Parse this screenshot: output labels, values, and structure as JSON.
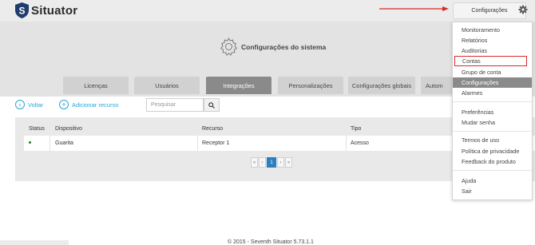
{
  "app": {
    "name": "Situator"
  },
  "topbar": {
    "config_button": "Configurações"
  },
  "header": {
    "title": "Configurações do sistema"
  },
  "tabs": [
    {
      "label": "Licenças"
    },
    {
      "label": "Usuários"
    },
    {
      "label": "Integrações",
      "active": true
    },
    {
      "label": "Personalizações"
    },
    {
      "label": "Configurações globais"
    },
    {
      "label": "Autom"
    }
  ],
  "toolbar": {
    "back_label": "Voltar",
    "add_label": "Adicionar recurso",
    "search_placeholder": "Pesquisar"
  },
  "table": {
    "columns": [
      "Status",
      "Dispositivo",
      "Recurso",
      "Tipo"
    ],
    "rows": [
      {
        "status": "active",
        "dispositivo": "Guarita",
        "recurso": "Receptor 1",
        "tipo": "Acesso"
      }
    ]
  },
  "pagination": {
    "first": "«",
    "prev": "‹",
    "current": "1",
    "next": "›",
    "last": "»"
  },
  "footer": {
    "text": "© 2015 - Seventh Situator 5.73.1.1"
  },
  "menu": {
    "items": [
      {
        "label": "Monitoramento"
      },
      {
        "label": "Relatórios"
      },
      {
        "label": "Auditorias"
      },
      {
        "label": "Contas",
        "highlighted": true
      },
      {
        "label": "Grupo de conta"
      },
      {
        "label": "Configurações",
        "selected": true
      },
      {
        "label": "Alarmes"
      },
      {
        "label": "Preferências"
      },
      {
        "label": "Mudar senha"
      },
      {
        "label": "Termos de uso"
      },
      {
        "label": "Política de privacidade"
      },
      {
        "label": "Feedback do produto"
      },
      {
        "label": "Ajuda"
      },
      {
        "label": "Sair"
      }
    ]
  },
  "colors": {
    "accent": "#2aa4d9",
    "pager_active": "#2a7fc1",
    "annotation_red": "#d9292b",
    "status_green": "#237a2b"
  }
}
